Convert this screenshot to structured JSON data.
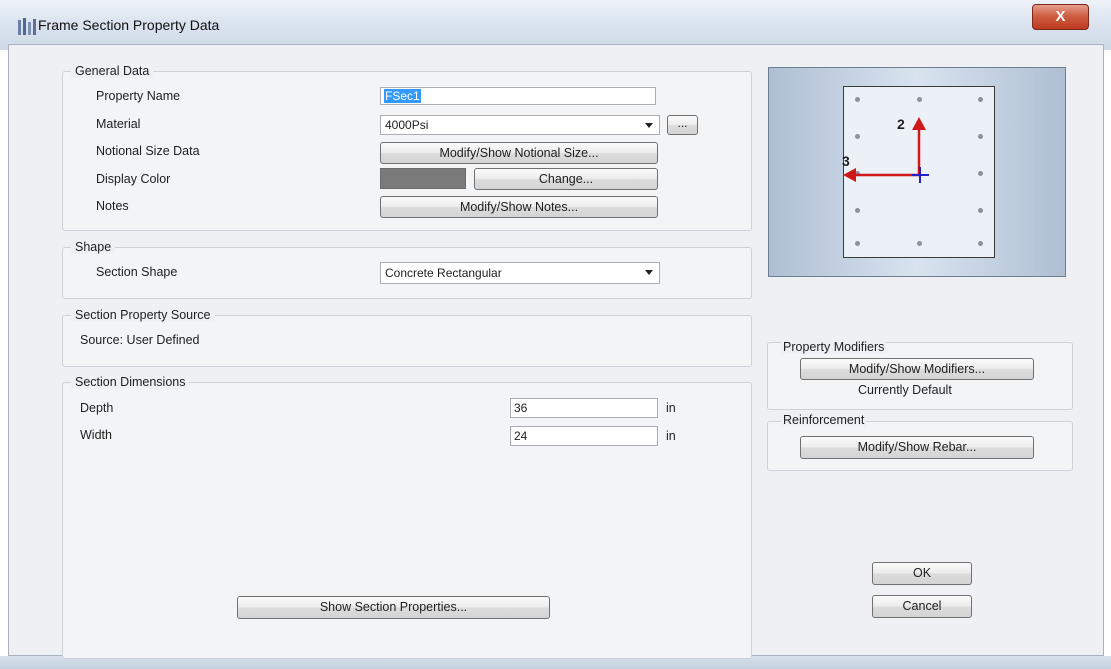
{
  "window": {
    "title": "Frame Section Property Data",
    "close_label": "X"
  },
  "general": {
    "title": "General Data",
    "property_name_label": "Property Name",
    "property_name_value": "FSec1",
    "material_label": "Material",
    "material_value": "4000Psi",
    "material_more_label": "...",
    "notional_label": "Notional Size Data",
    "notional_button": "Modify/Show Notional Size...",
    "color_label": "Display Color",
    "color_value": "#7a7a7a",
    "change_button": "Change...",
    "notes_label": "Notes",
    "notes_button": "Modify/Show Notes..."
  },
  "shape": {
    "title": "Shape",
    "section_shape_label": "Section Shape",
    "section_shape_value": "Concrete Rectangular"
  },
  "source": {
    "title": "Section Property Source",
    "text": "Source:  User Defined"
  },
  "dimensions": {
    "title": "Section Dimensions",
    "depth_label": "Depth",
    "depth_value": "36",
    "depth_unit": "in",
    "width_label": "Width",
    "width_value": "24",
    "width_unit": "in"
  },
  "preview": {
    "axis_2_label": "2",
    "axis_3_label": "3"
  },
  "modifiers": {
    "title": "Property Modifiers",
    "button": "Modify/Show Modifiers...",
    "status": "Currently Default"
  },
  "reinforcement": {
    "title": "Reinforcement",
    "button": "Modify/Show Rebar..."
  },
  "footer": {
    "show_props_button": "Show Section Properties...",
    "ok_button": "OK",
    "cancel_button": "Cancel"
  }
}
